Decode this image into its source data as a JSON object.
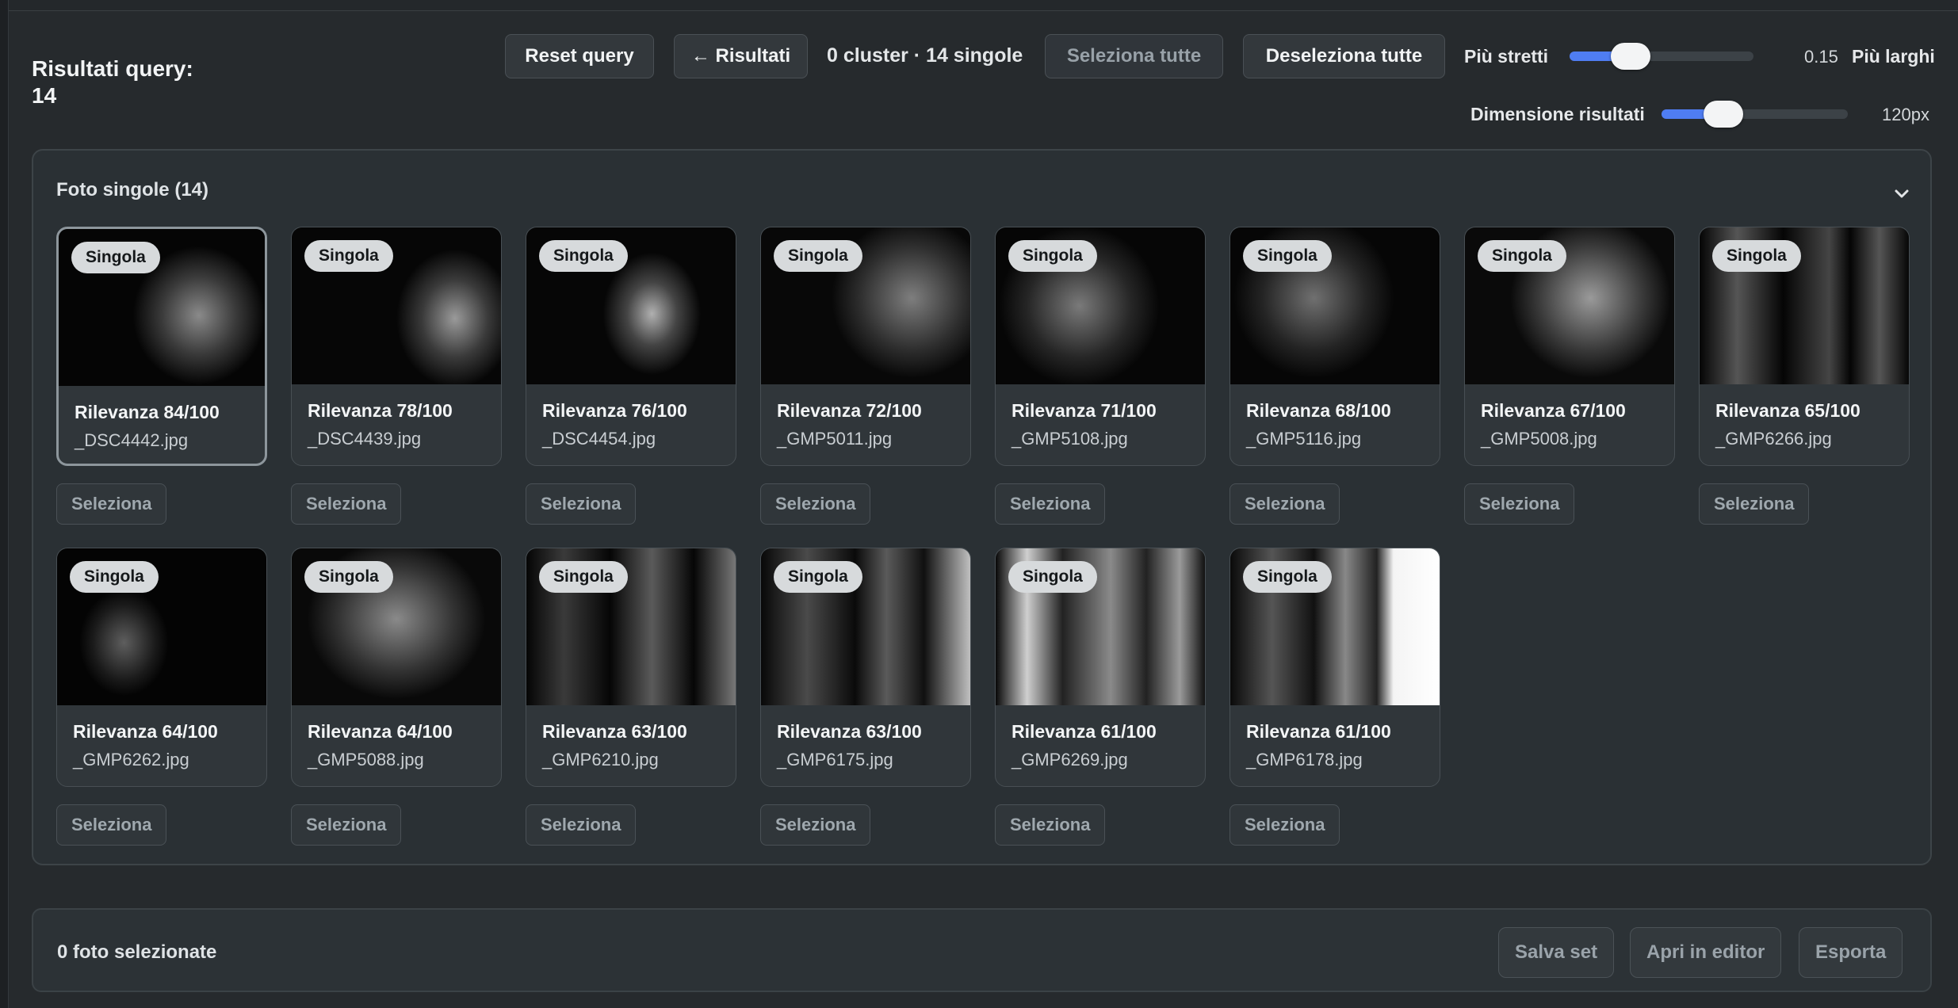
{
  "query": {
    "title_line1": "Risultati query:",
    "title_line2": "14"
  },
  "toolbar": {
    "reset_label": "Reset query",
    "back_label": "← Risultati",
    "cluster_count": "0 cluster · 14 singole",
    "select_all_label": "Seleziona tutte",
    "deselect_all_label": "Deseleziona tutte"
  },
  "similarity": {
    "left_label": "Più stretti",
    "right_label": "Più larghi",
    "value_text": "0.15",
    "level": 0.33
  },
  "result_size": {
    "label": "Dimensione risultati",
    "value_text": "120px",
    "level": 0.33
  },
  "panel": {
    "title": "Foto singole (14)"
  },
  "cards": [
    {
      "badge": "Singola",
      "score": "Rilevanza 84/100",
      "filename": "_DSC4442.jpg",
      "select_label": "Seleziona"
    },
    {
      "badge": "Singola",
      "score": "Rilevanza 78/100",
      "filename": "_DSC4439.jpg",
      "select_label": "Seleziona"
    },
    {
      "badge": "Singola",
      "score": "Rilevanza 76/100",
      "filename": "_DSC4454.jpg",
      "select_label": "Seleziona"
    },
    {
      "badge": "Singola",
      "score": "Rilevanza 72/100",
      "filename": "_GMP5011.jpg",
      "select_label": "Seleziona"
    },
    {
      "badge": "Singola",
      "score": "Rilevanza 71/100",
      "filename": "_GMP5108.jpg",
      "select_label": "Seleziona"
    },
    {
      "badge": "Singola",
      "score": "Rilevanza 68/100",
      "filename": "_GMP5116.jpg",
      "select_label": "Seleziona"
    },
    {
      "badge": "Singola",
      "score": "Rilevanza 67/100",
      "filename": "_GMP5008.jpg",
      "select_label": "Seleziona"
    },
    {
      "badge": "Singola",
      "score": "Rilevanza 65/100",
      "filename": "_GMP6266.jpg",
      "select_label": "Seleziona"
    },
    {
      "badge": "Singola",
      "score": "Rilevanza 64/100",
      "filename": "_GMP6262.jpg",
      "select_label": "Seleziona"
    },
    {
      "badge": "Singola",
      "score": "Rilevanza 64/100",
      "filename": "_GMP5088.jpg",
      "select_label": "Seleziona"
    },
    {
      "badge": "Singola",
      "score": "Rilevanza 63/100",
      "filename": "_GMP6210.jpg",
      "select_label": "Seleziona"
    },
    {
      "badge": "Singola",
      "score": "Rilevanza 63/100",
      "filename": "_GMP6175.jpg",
      "select_label": "Seleziona"
    },
    {
      "badge": "Singola",
      "score": "Rilevanza 61/100",
      "filename": "_GMP6269.jpg",
      "select_label": "Seleziona"
    },
    {
      "badge": "Singola",
      "score": "Rilevanza 61/100",
      "filename": "_GMP6178.jpg",
      "select_label": "Seleziona"
    }
  ],
  "footer": {
    "selected_text": "0 foto selezionate",
    "save_label": "Salva set",
    "editor_label": "Apri in editor",
    "export_label": "Esporta"
  },
  "colors": {
    "accent": "#4f7df2",
    "background": "#262a2d",
    "panel": "#2a3034",
    "card": "#30363a"
  }
}
